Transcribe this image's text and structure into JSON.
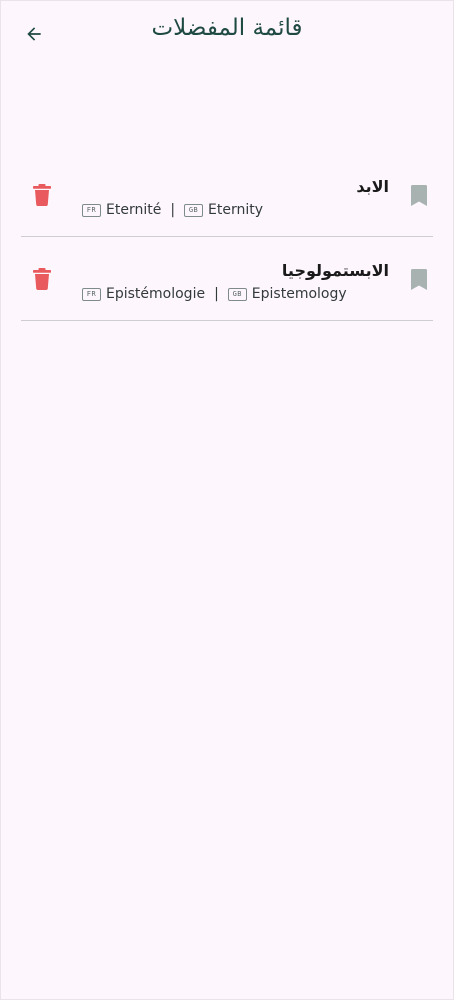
{
  "header": {
    "title": "قائمة المفضلات",
    "back_icon": "arrow-left-icon"
  },
  "colors": {
    "background": "#fdf7fd",
    "accent": "#1f4a43",
    "delete": "#e85a5d",
    "bookmark": "#a7b2b1",
    "divider": "#cfcdd0"
  },
  "favorites": [
    {
      "arabic": "الابد",
      "fr_code": "FR",
      "fr": "Eternité",
      "separator": "|",
      "gb_code": "GB",
      "en": "Eternity"
    },
    {
      "arabic": "الابستمولوجيا",
      "fr_code": "FR",
      "fr": "Epistémologie",
      "separator": "|",
      "gb_code": "GB",
      "en": "Epistemology"
    }
  ]
}
